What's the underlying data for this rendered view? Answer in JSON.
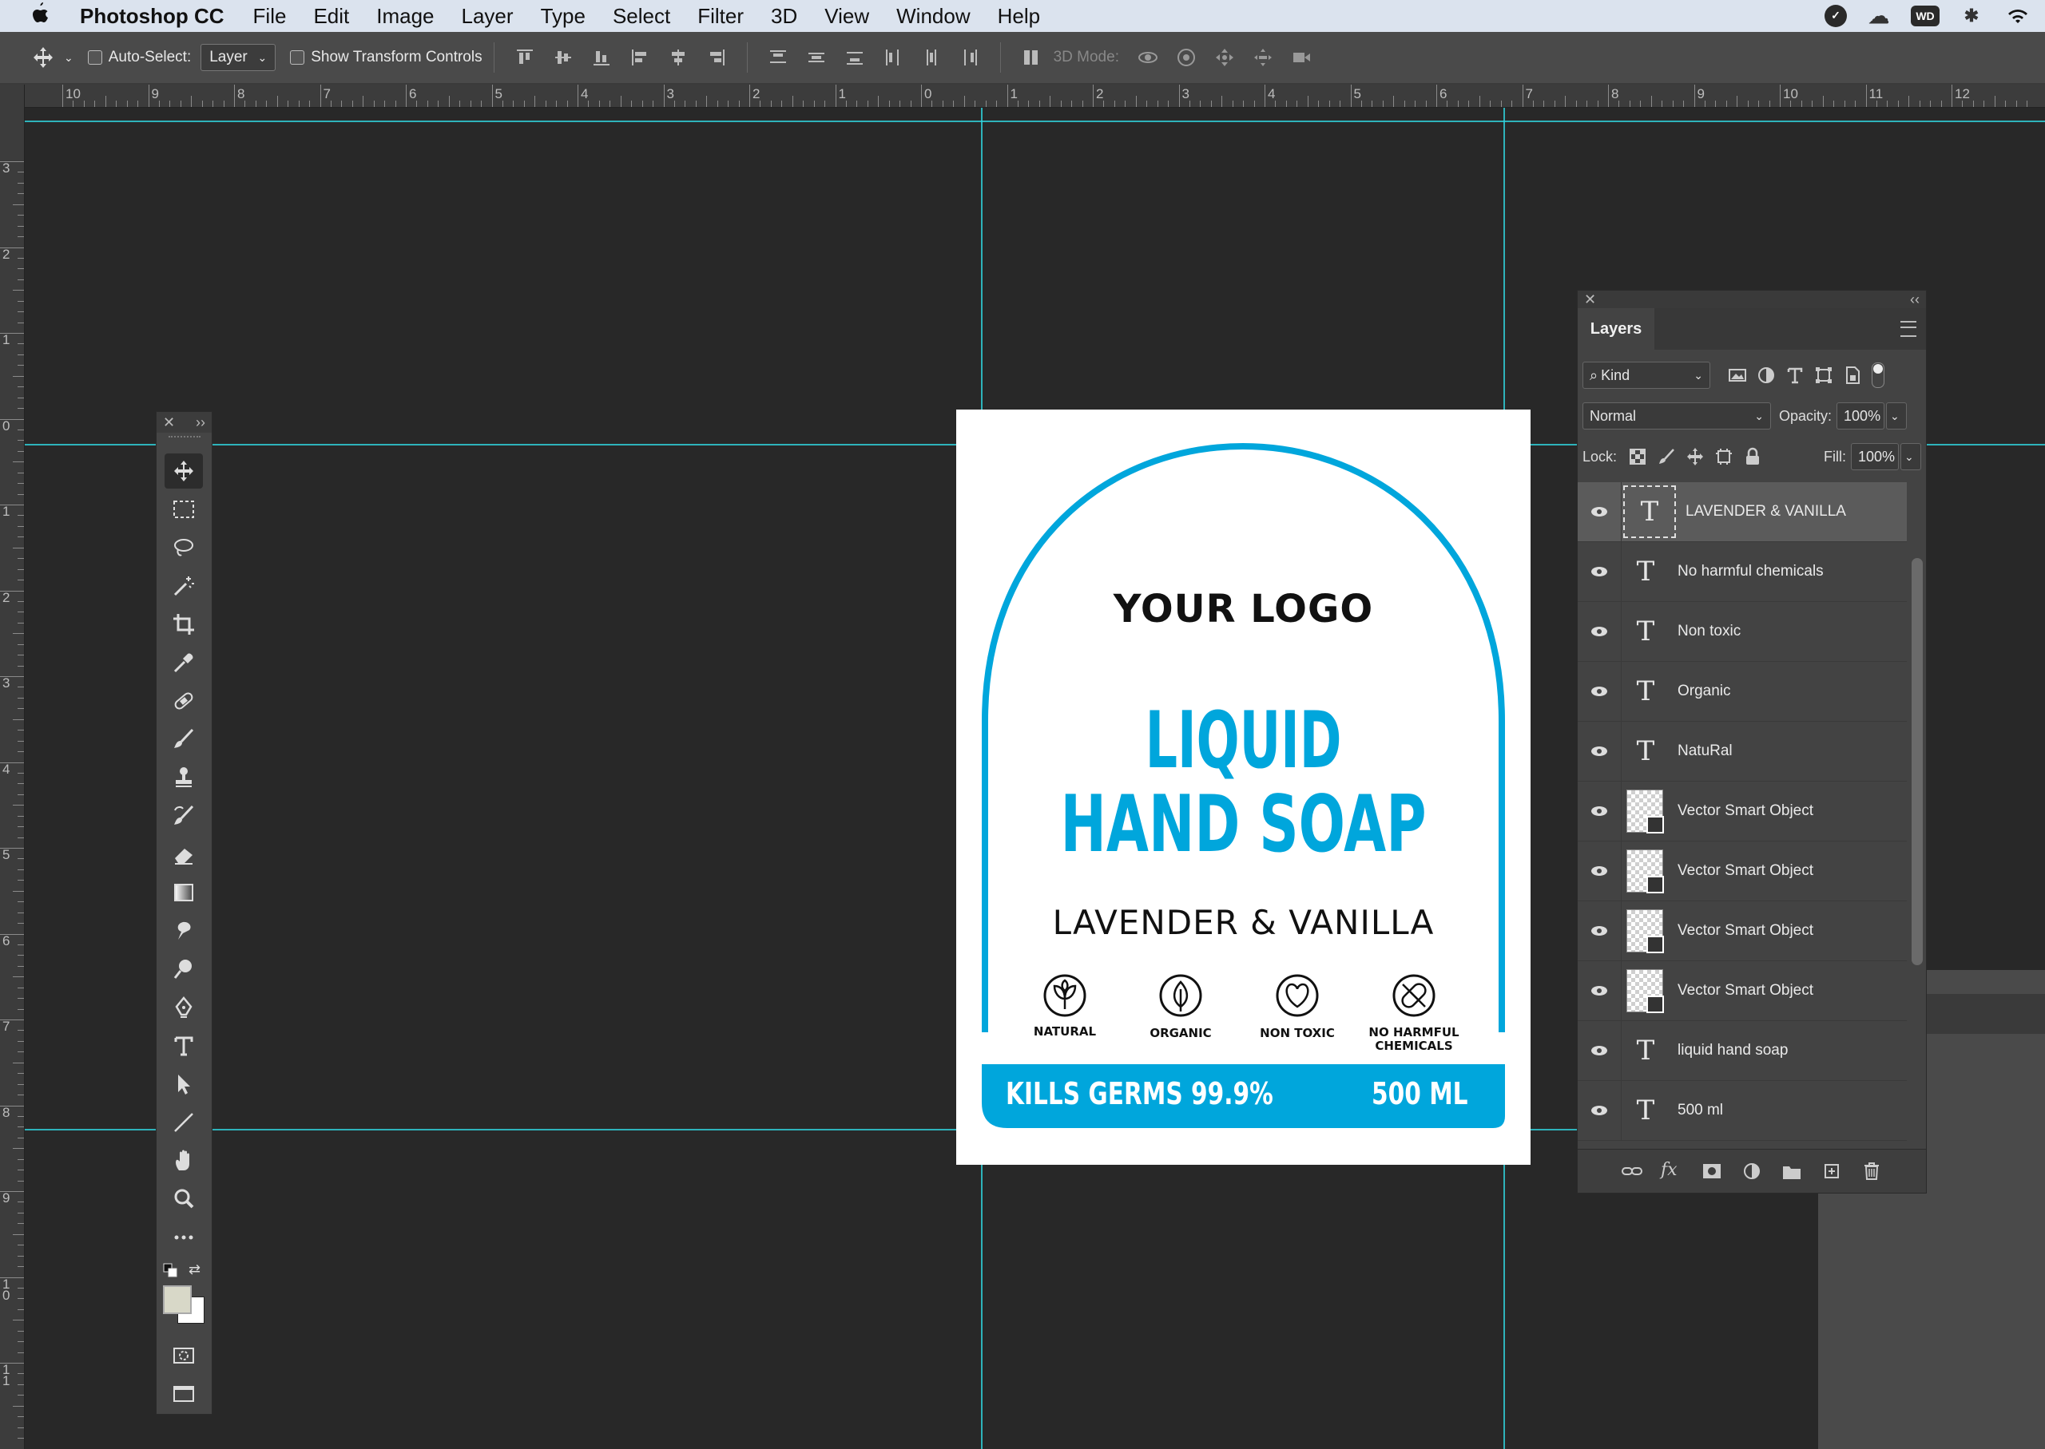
{
  "menubar": {
    "app_name": "Photoshop CC",
    "items": [
      "File",
      "Edit",
      "Image",
      "Layer",
      "Type",
      "Select",
      "Filter",
      "3D",
      "View",
      "Window",
      "Help"
    ],
    "status_icons": [
      "creative-cloud-icon",
      "cloud-icon",
      "wd-icon",
      "bluetooth-icon",
      "wifi-icon"
    ],
    "wd_label": "WD"
  },
  "options": {
    "auto_select_label": "Auto-Select:",
    "auto_select_value": "Layer",
    "transform_label": "Show Transform Controls",
    "mode_3d_label": "3D Mode:"
  },
  "rulers": {
    "horizontal": [
      "10",
      "9",
      "8",
      "7",
      "6",
      "5",
      "4",
      "3",
      "2",
      "1",
      "0",
      "1",
      "2",
      "3",
      "4",
      "5",
      "6",
      "7",
      "8",
      "9",
      "10",
      "11",
      "12"
    ],
    "vertical": [
      "3",
      "2",
      "1",
      "0",
      "1",
      "2",
      "3",
      "4",
      "5",
      "6",
      "7",
      "8",
      "9",
      "1\n0",
      "1\n1"
    ]
  },
  "label": {
    "logo": "YOUR LOGO",
    "title_line1": "LIQUID",
    "title_line2": "HAND SOAP",
    "scent": "LAVENDER & VANILLA",
    "icons": [
      {
        "name": "natural-icon",
        "text": "NATURAL"
      },
      {
        "name": "organic-icon",
        "text": "ORGANIC"
      },
      {
        "name": "non-toxic-icon",
        "text": "NON TOXIC"
      },
      {
        "name": "no-chemicals-icon",
        "text": "NO HARMFUL\nCHEMICALS"
      }
    ],
    "band_left": "KILLS GERMS 99.9%",
    "band_right": "500 ML",
    "accent": "#00a6dc"
  },
  "layers_panel": {
    "tab": "Layers",
    "kind_label": "Kind",
    "blend_mode": "Normal",
    "opacity_label": "Opacity:",
    "opacity_value": "100%",
    "lock_label": "Lock:",
    "fill_label": "Fill:",
    "fill_value": "100%",
    "layers": [
      {
        "name": "LAVENDER & VANILLA",
        "type": "text",
        "selected": true
      },
      {
        "name": "No harmful chemicals",
        "type": "text"
      },
      {
        "name": "Non toxic",
        "type": "text"
      },
      {
        "name": "Organic",
        "type": "text"
      },
      {
        "name": "NatuRal",
        "type": "text"
      },
      {
        "name": "Vector Smart Object",
        "type": "smart"
      },
      {
        "name": "Vector Smart Object",
        "type": "smart"
      },
      {
        "name": "Vector Smart Object",
        "type": "smart"
      },
      {
        "name": "Vector Smart Object",
        "type": "smart"
      },
      {
        "name": "liquid hand soap",
        "type": "text"
      },
      {
        "name": "500 ml",
        "type": "text"
      }
    ]
  },
  "colors": {
    "guide": "#2fd6e0",
    "canvas_bg": "#282828",
    "panel": "#434343",
    "foreground_swatch": "#d8d8c8",
    "background_swatch": "#ffffff"
  }
}
